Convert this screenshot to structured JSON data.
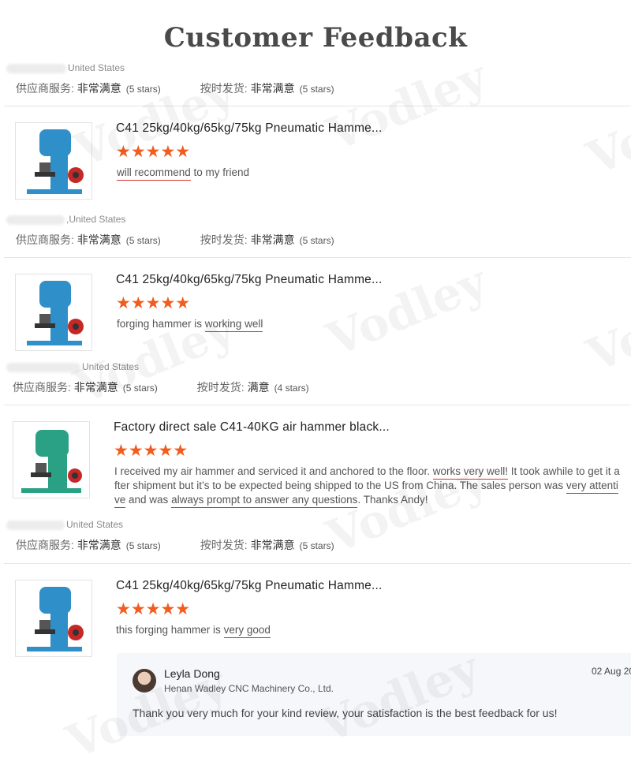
{
  "page": {
    "title": "Customer Feedback",
    "watermark": "Vodley"
  },
  "labels": {
    "supplier_service": "供应商服务:",
    "on_time_delivery": "按时发货:",
    "very_satisfied": "非常满意",
    "satisfied": "满意",
    "five_stars": "(5 stars)",
    "four_stars": "(4 stars)"
  },
  "entries": [
    {
      "country": "United States",
      "supplier_rating": "非常满意",
      "supplier_stars": "(5 stars)",
      "delivery_rating": "非常满意",
      "delivery_stars": "(5 stars)"
    },
    {
      "product": "C41 25kg/40kg/65kg/75kg Pneumatic Hamme...",
      "stars": 5,
      "review": {
        "a": "will recommend",
        "b": " to my friend"
      },
      "country": ",United States",
      "supplier_rating": "非常满意",
      "supplier_stars": "(5 stars)",
      "delivery_rating": "非常满意",
      "delivery_stars": "(5 stars)"
    },
    {
      "product": "C41 25kg/40kg/65kg/75kg Pneumatic Hamme...",
      "stars": 5,
      "review": {
        "a": "forging hammer is ",
        "b": "working well"
      },
      "country": "United States",
      "supplier_rating": "非常满意",
      "supplier_stars": "(5 stars)",
      "delivery_rating": "满意",
      "delivery_stars": "(4 stars)"
    },
    {
      "product": "Factory direct sale C41-40KG air hammer black...",
      "stars": 5,
      "review": {
        "p1": "I received my air hammer and serviced it and anchored to the floor. ",
        "u1": "works very well!",
        "p2": " It took awhile to get it a",
        "line2": "fter shipment but it’s to be expected being shipped to the US from China. The sales person was ",
        "u2a": "very attenti",
        "u2b": "ve",
        "p3": " and was ",
        "u3": "always prompt to answer any questions",
        "p4": ". Thanks Andy!"
      },
      "country": "United States",
      "supplier_rating": "非常满意",
      "supplier_stars": "(5 stars)",
      "delivery_rating": "非常满意",
      "delivery_stars": "(5 stars)"
    },
    {
      "product": "C41 25kg/40kg/65kg/75kg Pneumatic Hamme...",
      "stars": 5,
      "review": {
        "a": "this forging hammer is ",
        "b": "very good"
      },
      "reply": {
        "name": "Leyla Dong",
        "company": "Henan Wadley CNC Machinery Co., Ltd.",
        "date": "02 Aug 20",
        "text": "Thank you very much for your kind review, your satisfaction is the best feedback for us!"
      }
    }
  ],
  "colors": {
    "star": "#f25c1e",
    "underline": "#d9302b",
    "hammer_blue": "#2f8fc8",
    "hammer_green": "#2aa184"
  },
  "icons": [
    "star-icon",
    "avatar",
    "hammer-product-image"
  ]
}
